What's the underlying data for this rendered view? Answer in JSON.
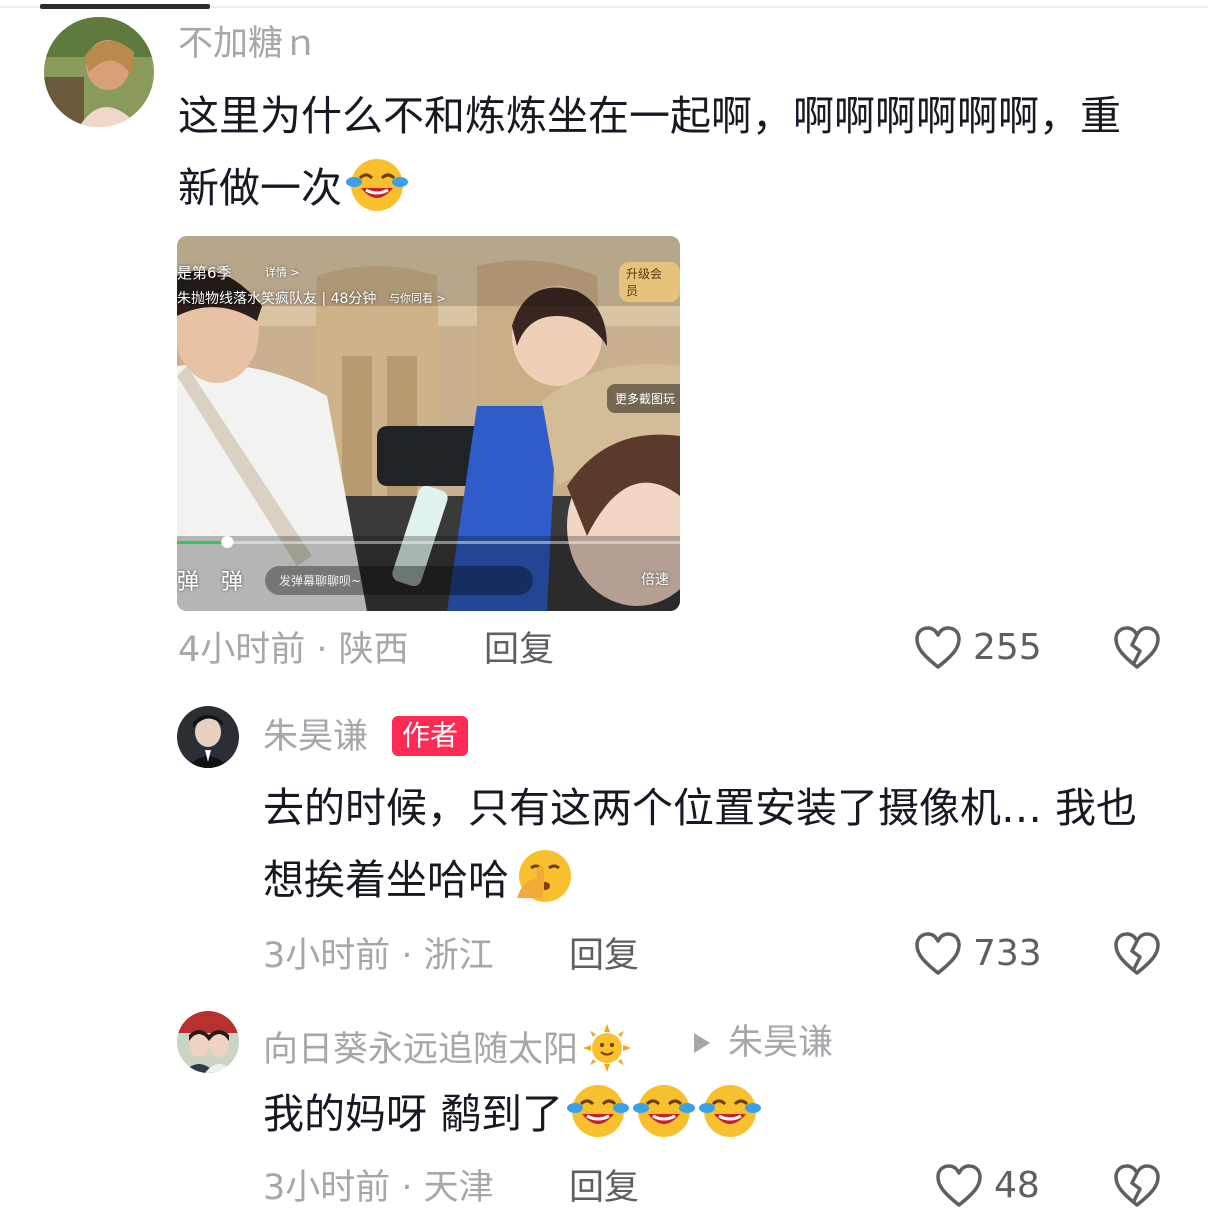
{
  "comments": [
    {
      "username": "不加糖ｎ",
      "text": "这里为什么不和炼炼坐在一起啊，啊啊啊啊啊啊，重新做一次",
      "emoji": "crying-laughing",
      "video": {
        "title_fragment": "是第6季",
        "detail_label": "详情 >",
        "episode_line": "朱抛物线落水笑疯队友 | 48分钟",
        "watch_together": "与你同看 >",
        "vip_label": "升级会员",
        "screenshot_label": "更多截图玩",
        "danmu_left": "弹",
        "danmu_right": "弹",
        "danmu_placeholder": "发弹幕聊聊呗~",
        "speed_label": "倍速",
        "progress": 0.1
      },
      "time_location": "4小时前 · 陕西",
      "reply_label": "回复",
      "like_count": "255"
    },
    {
      "username": "朱昊谦",
      "badge": "作者",
      "text": "去的时候，只有这两个位置安装了摄像机… 我也想挨着坐哈哈",
      "emoji": "shushing-face",
      "time_location": "3小时前 · 浙江",
      "reply_label": "回复",
      "like_count": "733"
    },
    {
      "username": "向日葵永远追随太阳",
      "username_emoji": "sun-face",
      "reply_to": "朱昊谦",
      "text": "我的妈呀 鹬到了",
      "emoji": "crying-laughing",
      "time_location": "3小时前 · 天津",
      "reply_label": "回复",
      "like_count": "48"
    }
  ],
  "colors": {
    "text": "#161823",
    "secondary": "#a6a6ab",
    "author_badge": "#fe2c55",
    "emoji_yellow": "#f7c02c"
  }
}
